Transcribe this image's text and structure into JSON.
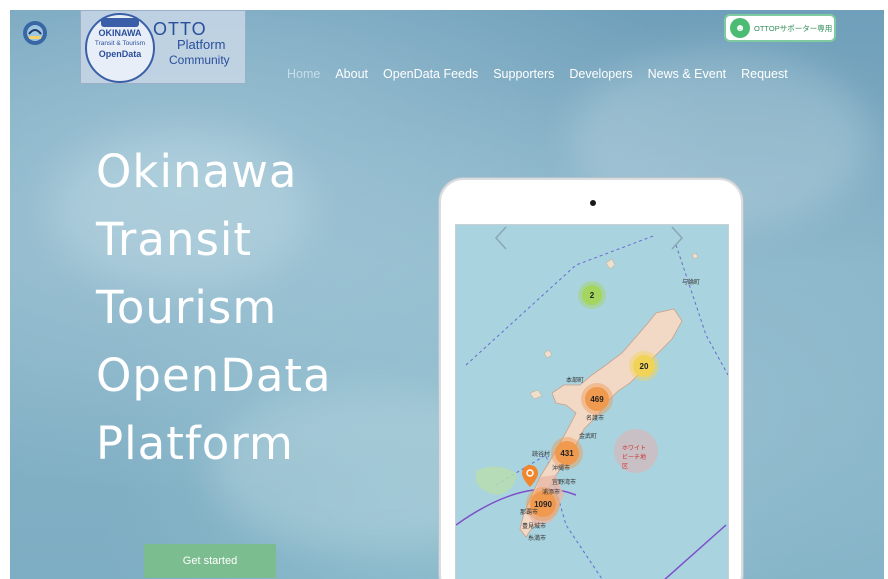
{
  "header": {
    "logo": {
      "circle_line1": "OKINAWA",
      "circle_line2": "Transit & Tourism",
      "circle_line3": "OpenData",
      "otto": "OTTO",
      "platform": "Platform",
      "community": "Community"
    },
    "supporter_button": "OTTOPサポーター専用"
  },
  "nav": {
    "items": [
      "Home",
      "About",
      "OpenData Feeds",
      "Supporters",
      "Developers",
      "News & Event",
      "Request"
    ],
    "active": "Home"
  },
  "hero": {
    "title_lines": [
      "Okinawa",
      "Transit",
      "Tourism",
      "OpenData",
      "Platform"
    ],
    "cta_label": "Get started"
  },
  "map": {
    "clusters": [
      "2",
      "20",
      "469",
      "431",
      "1090"
    ],
    "labels": [
      "与論町",
      "本部町",
      "名護市",
      "金武町",
      "読谷村",
      "沖縄市",
      "宜野湾市",
      "浦添市",
      "那覇市",
      "豊見城市",
      "糸満市",
      "ホワイトビーチ地区"
    ]
  },
  "colors": {
    "accent_green": "#7bbd8e",
    "cluster_green": "#a3d55f",
    "cluster_yellow": "#f1d357",
    "cluster_orange": "#f09a50"
  }
}
